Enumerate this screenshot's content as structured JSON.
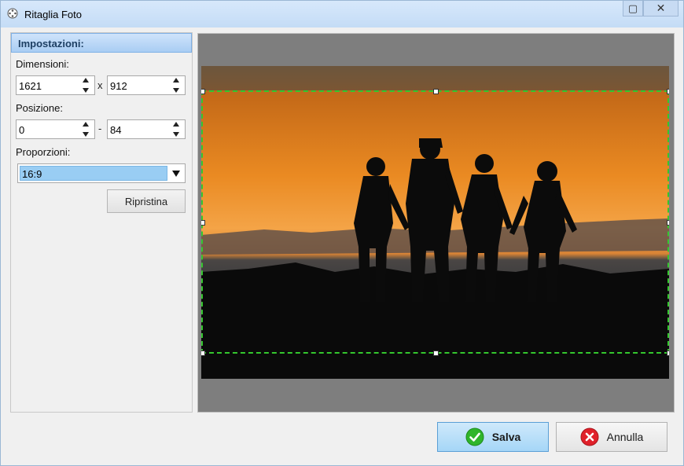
{
  "window": {
    "title": "Ritaglia Foto",
    "maximize_glyph": "▢",
    "close_glyph": "✕"
  },
  "settings": {
    "header": "Impostazioni:",
    "dimensions_label": "Dimensioni:",
    "width": "1621",
    "height": "912",
    "dim_separator": "x",
    "position_label": "Posizione:",
    "pos_x": "0",
    "pos_y": "84",
    "pos_separator": "-",
    "proportions_label": "Proporzioni:",
    "proportion_value": "16:9",
    "reset_label": "Ripristina"
  },
  "actions": {
    "save_label": "Salva",
    "cancel_label": "Annulla"
  },
  "colors": {
    "crop_border": "#34c72e",
    "save_icon": "#2fb52a",
    "cancel_icon": "#e0202a"
  },
  "icons": {
    "save": "check-icon",
    "cancel": "x-circle-icon",
    "app": "film-reel-icon"
  }
}
